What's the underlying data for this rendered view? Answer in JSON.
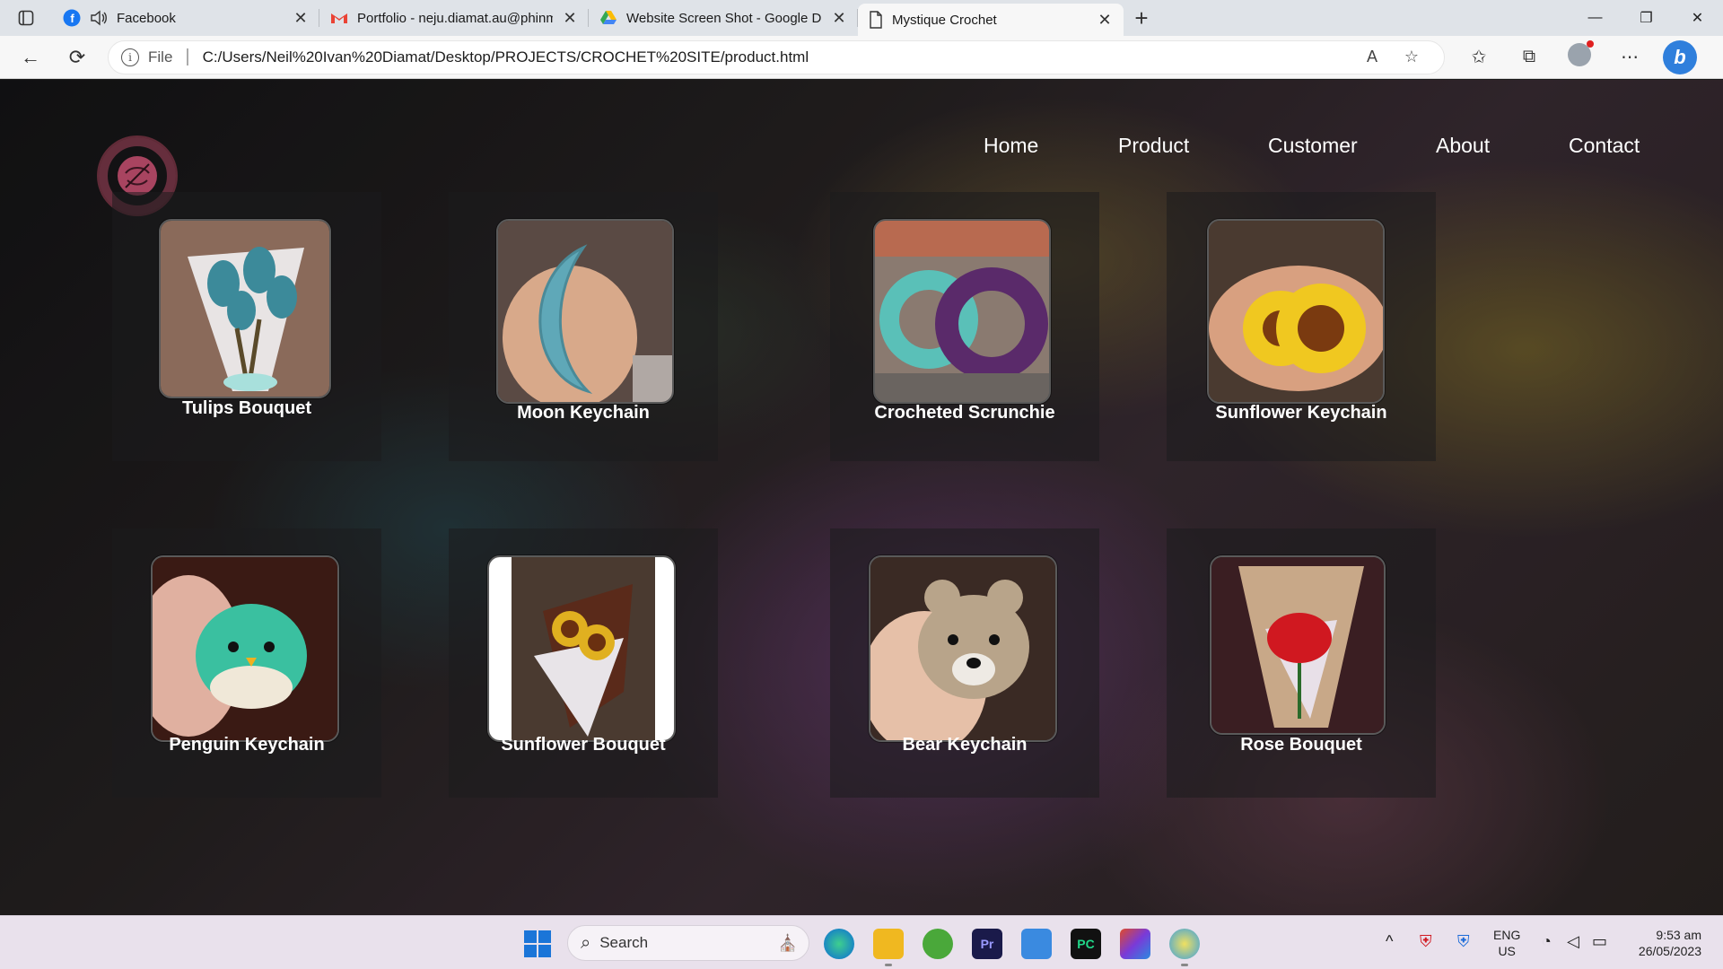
{
  "browser": {
    "tabs": [
      {
        "title": "Facebook",
        "icon": "facebook-icon",
        "close": "✕"
      },
      {
        "title": "Portfolio - neju.diamat.au@phinma.edu.ph",
        "icon": "gmail-icon",
        "close": "✕"
      },
      {
        "title": "Website Screen Shot - Google Docs",
        "icon": "google-drive-icon",
        "close": "✕"
      },
      {
        "title": "Mystique Crochet",
        "icon": "page-icon",
        "close": "✕"
      }
    ],
    "new_tab": "+",
    "window_controls": {
      "minimize": "—",
      "restore": "❐",
      "close": "✕"
    },
    "address": {
      "scheme_label": "File",
      "url": "C:/Users/Neil%20Ivan%20Diamat/Desktop/PROJECTS/CROCHET%20SITE/product.html"
    },
    "toolbar": {
      "back": "←",
      "reload": "⟳",
      "read_aloud": "A",
      "add_favorite": "☆",
      "favorites": "✩",
      "collections": "⧉",
      "more": "⋯",
      "bing": "b"
    }
  },
  "site": {
    "logo_alt": "Mystique Crochet logo",
    "nav": [
      "Home",
      "Product",
      "Customer",
      "About",
      "Contact"
    ],
    "products": [
      {
        "name": "Tulips Bouquet",
        "photo": "tulips-bouquet",
        "palette": [
          "#8a6a5a",
          "#3c8a9a",
          "#e8e4e4"
        ]
      },
      {
        "name": "Moon Keychain",
        "photo": "moon-keychain",
        "palette": [
          "#5a4a44",
          "#5fa8b8",
          "#d8a98a"
        ]
      },
      {
        "name": "Crocheted Scrunchie",
        "photo": "crocheted-scrunchie",
        "palette": [
          "#8a7a70",
          "#5ac0b8",
          "#5a2a6a"
        ]
      },
      {
        "name": "Sunflower Keychain",
        "photo": "sunflower-keychain",
        "palette": [
          "#4a3a30",
          "#f0c820",
          "#7a3a10"
        ]
      },
      {
        "name": "Penguin Keychain",
        "photo": "penguin-keychain",
        "palette": [
          "#3a1a14",
          "#3ac0a0",
          "#e0b0a0"
        ]
      },
      {
        "name": "Sunflower Bouquet",
        "photo": "sunflower-bouquet",
        "palette": [
          "#ffffff",
          "#5a2a1a",
          "#e0b020"
        ]
      },
      {
        "name": "Bear Keychain",
        "photo": "bear-keychain",
        "palette": [
          "#3a2a24",
          "#b8a48a",
          "#e6c0a8"
        ]
      },
      {
        "name": "Rose Bouquet",
        "photo": "rose-bouquet",
        "palette": [
          "#3a1e22",
          "#c8a888",
          "#d01820"
        ]
      }
    ]
  },
  "taskbar": {
    "search_label": "Search",
    "apps": [
      "edge-icon",
      "file-explorer-icon",
      "utorrent-icon",
      "premiere-pro-icon",
      "notepad-icon",
      "pycharm-icon",
      "office-icon",
      "paint-icon"
    ],
    "premiere_label": "Pr",
    "pycharm_label": "PC",
    "tray": {
      "chevron": "^",
      "language": "ENG",
      "region": "US",
      "time": "9:53 am",
      "date": "26/05/2023"
    }
  }
}
